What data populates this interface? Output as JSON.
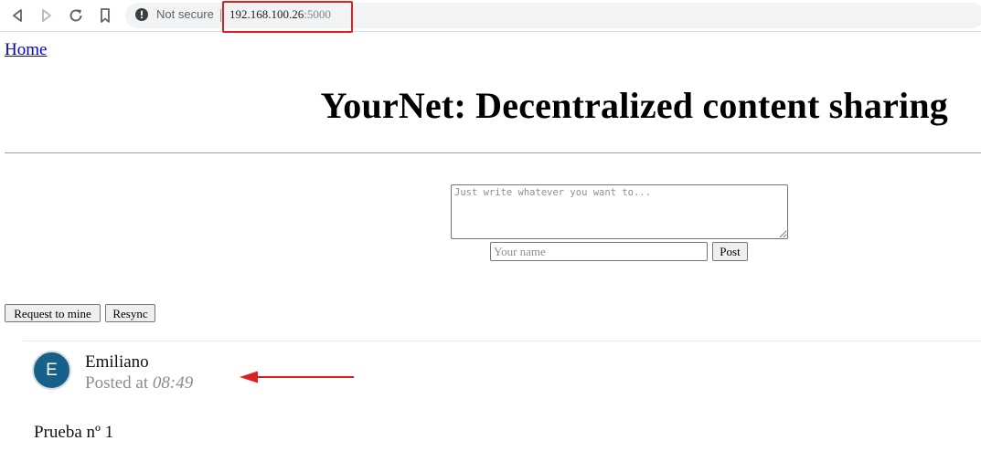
{
  "browser": {
    "security_label": "Not secure",
    "url_host": "192.168.100.26",
    "url_port": ":5000"
  },
  "nav": {
    "home_label": "Home"
  },
  "header": {
    "title": "YourNet: Decentralized content sharing"
  },
  "composer": {
    "text_placeholder": "Just write whatever you want to...",
    "name_placeholder": "Your name",
    "post_label": "Post"
  },
  "actions": {
    "mine_label": "Request to mine",
    "resync_label": "Resync"
  },
  "posts": [
    {
      "avatar_letter": "E",
      "author": "Emiliano",
      "posted_prefix": "Posted at",
      "time": "08:49",
      "content": "Prueba nº 1"
    }
  ],
  "colors": {
    "avatar": "#176089",
    "annotation": "#e02020",
    "link": "#0000ee"
  }
}
